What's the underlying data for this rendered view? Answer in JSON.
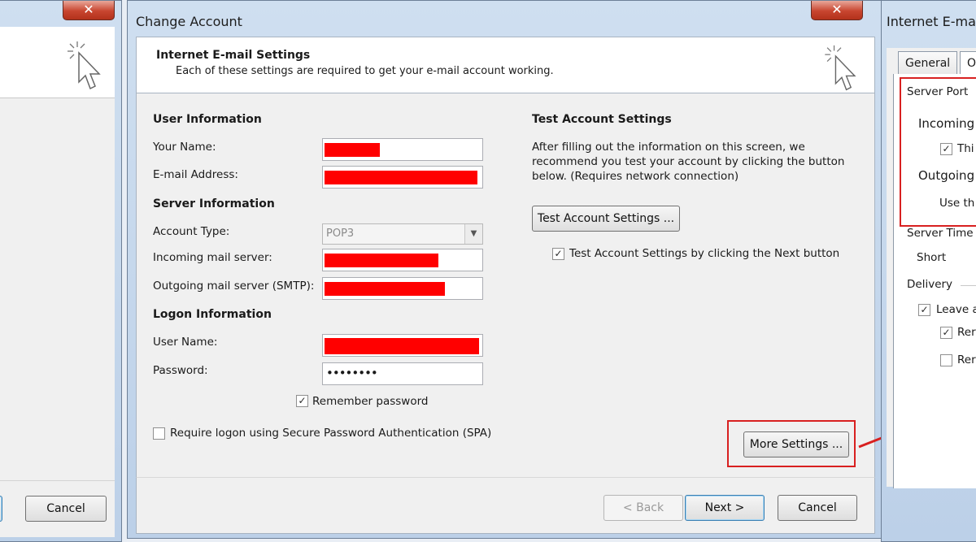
{
  "left_window": {
    "close_glyph": "✕",
    "cancel_label": "Cancel"
  },
  "main_window": {
    "title": "Change Account",
    "close_glyph": "✕",
    "header": {
      "title": "Internet E-mail Settings",
      "description": "Each of these settings are required to get your e-mail account working."
    },
    "user_info": {
      "heading": "User Information",
      "your_name_label": "Your Name:",
      "email_label": "E-mail Address:"
    },
    "server_info": {
      "heading": "Server Information",
      "account_type_label": "Account Type:",
      "account_type_value": "POP3",
      "incoming_label": "Incoming mail server:",
      "outgoing_label": "Outgoing mail server (SMTP):"
    },
    "logon_info": {
      "heading": "Logon Information",
      "user_name_label": "User Name:",
      "password_label": "Password:",
      "password_value": "••••••••",
      "remember_password_label": "Remember password",
      "spa_label": "Require logon using Secure Password Authentication (SPA)"
    },
    "test_settings": {
      "heading": "Test Account Settings",
      "description_line1": "After filling out the information on this screen, we",
      "description_line2": "recommend you test your account by clicking the button",
      "description_line3": "below. (Requires network connection)",
      "test_button_label": "Test Account Settings ...",
      "test_on_next_label": "Test Account Settings by clicking the Next button"
    },
    "more_settings_label": "More Settings ...",
    "footer": {
      "back_label": "< Back",
      "next_label": "Next >",
      "cancel_label": "Cancel"
    },
    "checkboxes": {
      "remember_password": true,
      "spa": false,
      "test_on_next": true
    }
  },
  "right_window": {
    "title": "Internet E-ma",
    "tabs": [
      "General",
      "O"
    ],
    "server_port_label": "Server Port",
    "incoming_label": "Incoming",
    "this_label": "Thi",
    "outgoing_label": "Outgoing",
    "use_label": "Use th",
    "server_timeout_label": "Server Time",
    "short_label": "Short",
    "delivery_label": "Delivery",
    "leave_label": "Leave a",
    "rem1_label": "Rer",
    "rem2_label": "Rer"
  },
  "colors": {
    "highlight_red": "#d82020",
    "redaction": "#ff0000",
    "window_frame": "#dbe6f3"
  }
}
